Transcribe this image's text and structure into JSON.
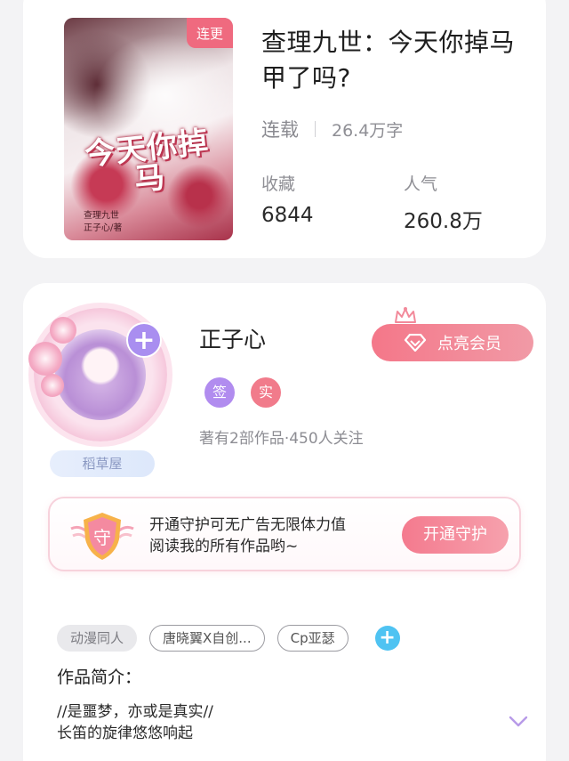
{
  "book": {
    "badge": "连更",
    "cover_title": "今天你掉马",
    "cover_author_line1": "查理九世",
    "cover_author_line2": "正子心/著",
    "title": "查理九世：今天你掉马甲了吗?",
    "status": "连载",
    "word_count": "26.4万字",
    "favorites_label": "收藏",
    "favorites_value": "6844",
    "popularity_label": "人气",
    "popularity_value": "260.8万"
  },
  "author": {
    "name": "正子心",
    "platform_badge": "稻草屋",
    "tag_sign": "签",
    "tag_real": "实",
    "stats": "著有2部作品·450人关注",
    "vip_button": "点亮会员",
    "add_label": "+"
  },
  "guard": {
    "shield_char": "守",
    "text_line1": "开通守护可无广告无限体力值",
    "text_line2": "阅读我的所有作品哟~",
    "button": "开通守护"
  },
  "tags": [
    "动漫同人",
    "唐晓翼X自创...",
    "Cp亚瑟"
  ],
  "tag_add": "+",
  "intro": {
    "label": "作品简介：",
    "line1": "//是噩梦，亦或是真实//",
    "line2": "长笛的旋律悠悠响起"
  },
  "colors": {
    "accent_pink": "#f47789",
    "accent_purple": "#a98ef0",
    "accent_blue": "#4fc3f2"
  },
  "icons": [
    "gem-icon",
    "crown-icon",
    "shield-icon",
    "chevron-down-icon",
    "plus-icon"
  ]
}
